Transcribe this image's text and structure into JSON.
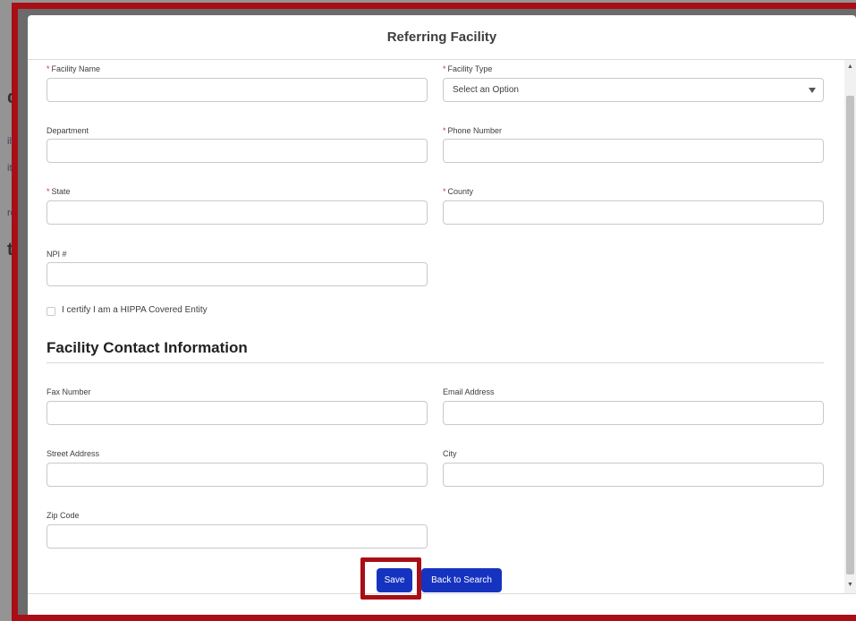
{
  "background": {
    "fragments": [
      "d",
      "illi",
      "ith",
      "rof",
      "ta"
    ]
  },
  "modal": {
    "title": "Referring Facility",
    "fields": {
      "facility_name": {
        "label": "Facility Name",
        "required": "*",
        "value": ""
      },
      "facility_type": {
        "label": "Facility Type",
        "required": "*",
        "value": "Select an Option"
      },
      "department": {
        "label": "Department",
        "value": ""
      },
      "phone_number": {
        "label": "Phone Number",
        "required": "*",
        "value": ""
      },
      "state": {
        "label": "State",
        "required": "*",
        "value": ""
      },
      "county": {
        "label": "County",
        "required": "*",
        "value": ""
      },
      "npi": {
        "label": "NPI #",
        "value": ""
      }
    },
    "certify_label": "I certify I am a HIPPA Covered Entity",
    "contact_section_title": "Facility Contact Information",
    "contact_fields": {
      "fax_number": {
        "label": "Fax Number",
        "value": ""
      },
      "email_address": {
        "label": "Email Address",
        "value": ""
      },
      "street_address": {
        "label": "Street Address",
        "value": ""
      },
      "city": {
        "label": "City",
        "value": ""
      },
      "zip_code": {
        "label": "Zip Code",
        "value": ""
      }
    },
    "buttons": {
      "save": "Save",
      "back_to_search": "Back to Search"
    }
  },
  "colors": {
    "primary_button": "#1633c0",
    "highlight": "#a90e16",
    "required": "#c23934"
  }
}
